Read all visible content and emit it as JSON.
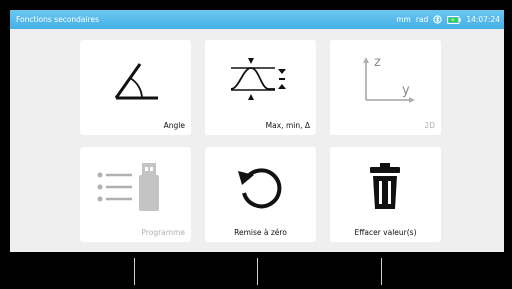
{
  "statusbar": {
    "title": "Fonctions secondaires",
    "units_length": "mm",
    "units_angle": "rad",
    "time": "14:07:24",
    "icons": [
      "bluetooth-icon",
      "battery-charging-icon"
    ]
  },
  "tiles": [
    {
      "label": "Angle",
      "icon": "angle-icon"
    },
    {
      "label": "Max, min, Δ",
      "icon": "max-min-icon"
    },
    {
      "label": "2D",
      "icon": "axes-2d-icon",
      "axis_z": "z",
      "axis_y": "y"
    },
    {
      "label": "Programme",
      "icon": "program-usb-icon"
    },
    {
      "label": "Remise à zéro",
      "icon": "reset-icon"
    },
    {
      "label": "Effacer valeur(s)",
      "icon": "trash-icon"
    }
  ],
  "colors": {
    "statusbar": "#43b0e6",
    "background": "#efefef",
    "tile": "#ffffff",
    "disabled": "#b0b0b0"
  }
}
